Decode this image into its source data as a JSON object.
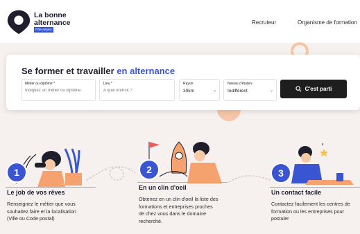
{
  "header": {
    "brand_line1": "La bonne",
    "brand_line2": "alternance",
    "brand_badge": "Pôle emploi",
    "nav": [
      "Recruteur",
      "Organisme de formation"
    ]
  },
  "hero": {
    "title_part1": "Se former et travailler",
    "title_part2": "en alternance"
  },
  "search": {
    "job_label": "Métier ou diplôme *",
    "job_placeholder": "Indiquez un métier ou diplôme",
    "place_label": "Lieu *",
    "place_placeholder": "A quel endroit ?",
    "radius_label": "Rayon",
    "radius_value": "30km",
    "level_label": "Niveau d'études",
    "level_value": "Indifférent",
    "button_label": "C'est parti"
  },
  "steps": [
    {
      "number": "1",
      "title": "Le job de vos rêves",
      "desc": [
        "Renseignez le métier que vous",
        "souhaitez faire et la localisation",
        "(Ville ou Code postal)"
      ]
    },
    {
      "number": "2",
      "title": "En un clin d'oeil",
      "desc": [
        "Obtenez en un clin d'oeil la liste des",
        "formations et entreprises proches",
        "de chez vous dans le domaine",
        "recherché."
      ]
    },
    {
      "number": "3",
      "title": "Un contact facile",
      "desc": [
        "Contactez facilement les centres de",
        "formation ou les entreprises pour",
        "postuler"
      ]
    }
  ],
  "colors": {
    "accent": "#3a55d1",
    "dark": "#1e1e1e",
    "hero_bg": "#f6f1ef",
    "deco_orange": "#f5a26e"
  },
  "icons": [
    "location-pin-icon",
    "search-icon",
    "chevron-down-icon"
  ]
}
